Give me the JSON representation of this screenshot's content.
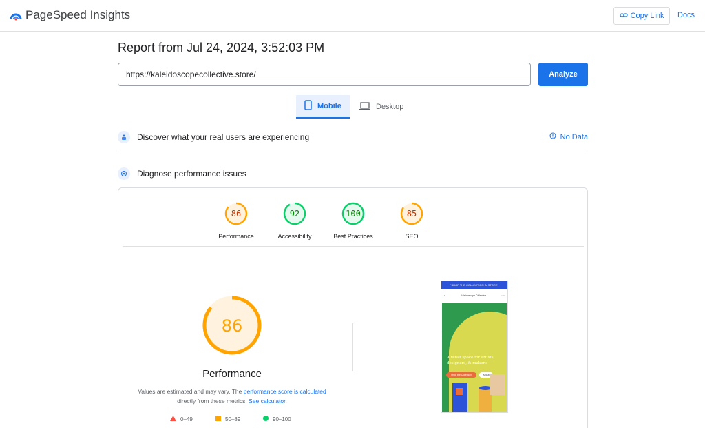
{
  "header": {
    "brand": "PageSpeed Insights",
    "copy_link": "Copy Link",
    "docs": "Docs"
  },
  "report": {
    "title": "Report from Jul 24, 2024, 3:52:03 PM",
    "url_value": "https://kaleidoscopecollective.store/",
    "analyze": "Analyze"
  },
  "tabs": [
    {
      "label": "Mobile",
      "icon": "smartphone-icon",
      "active": true
    },
    {
      "label": "Desktop",
      "icon": "laptop-icon",
      "active": false
    }
  ],
  "sections": {
    "real_users": {
      "title": "Discover what your real users are experiencing",
      "status": "No Data"
    },
    "diagnose": {
      "title": "Diagnose performance issues"
    }
  },
  "scores": [
    {
      "label": "Performance",
      "value": "86",
      "fraction": 0.86,
      "color": "#ffa400",
      "text_color": "#c33300"
    },
    {
      "label": "Accessibility",
      "value": "92",
      "fraction": 0.92,
      "color": "#0cce6b",
      "text_color": "#008800"
    },
    {
      "label": "Best Practices",
      "value": "100",
      "fraction": 1.0,
      "color": "#0cce6b",
      "text_color": "#008800"
    },
    {
      "label": "SEO",
      "value": "85",
      "fraction": 0.85,
      "color": "#ffa400",
      "text_color": "#c33300"
    }
  ],
  "performance": {
    "score": "86",
    "fraction": 0.86,
    "title": "Performance",
    "note_prefix": "Values are estimated and may vary. The ",
    "note_link1": "performance score is calculated",
    "note_mid": " directly from these metrics. ",
    "note_link2": "See calculator.",
    "legend": [
      {
        "range": "0–49",
        "shape": "triangle",
        "color": "#ff4e42"
      },
      {
        "range": "50–89",
        "shape": "square",
        "color": "#ffa400"
      },
      {
        "range": "90–100",
        "shape": "circle",
        "color": "#0cce6b"
      }
    ]
  },
  "screenshot": {
    "banner": "*SHOP THE COLLECTION IN STORE*",
    "site_name": "Kaleidoscope Collective",
    "hero_text": "A retail space for artists, designers, & makers",
    "btn_primary": "Shop the Collection",
    "btn_secondary": "About"
  }
}
